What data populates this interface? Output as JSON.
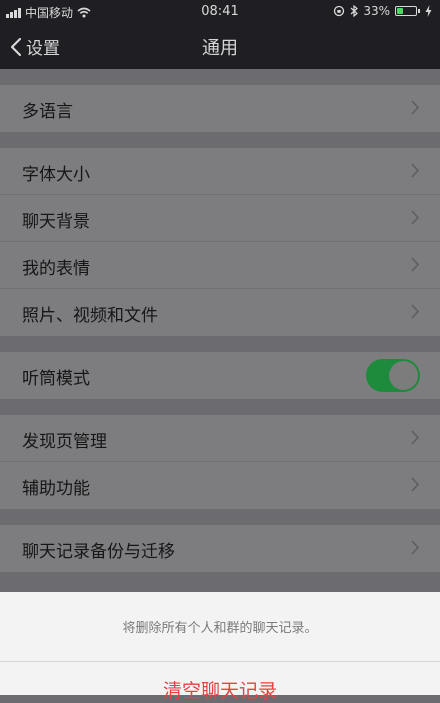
{
  "status_bar": {
    "carrier": "中国移动",
    "time": "08:41",
    "battery_percent": "33%",
    "battery_level": 0.33,
    "icons": [
      "signal-icon",
      "wifi-icon",
      "lock-rotation-icon",
      "bluetooth-icon",
      "battery-icon",
      "charging-icon"
    ]
  },
  "nav": {
    "back_label": "设置",
    "title": "通用"
  },
  "settings": {
    "group1": [
      {
        "label": "多语言"
      }
    ],
    "group2": [
      {
        "label": "字体大小"
      },
      {
        "label": "聊天背景"
      },
      {
        "label": "我的表情"
      },
      {
        "label": "照片、视频和文件"
      }
    ],
    "group3": [
      {
        "label": "听筒模式",
        "toggle_on": true
      }
    ],
    "group4": [
      {
        "label": "发现页管理"
      },
      {
        "label": "辅助功能"
      }
    ],
    "group5": [
      {
        "label": "聊天记录备份与迁移"
      }
    ]
  },
  "action_sheet": {
    "message": "将删除所有个人和群的聊天记录。",
    "danger_button": "清空聊天记录"
  },
  "colors": {
    "accent_green": "#1d8a3c",
    "danger_red": "#e64340",
    "nav_background": "#1f1f23"
  }
}
